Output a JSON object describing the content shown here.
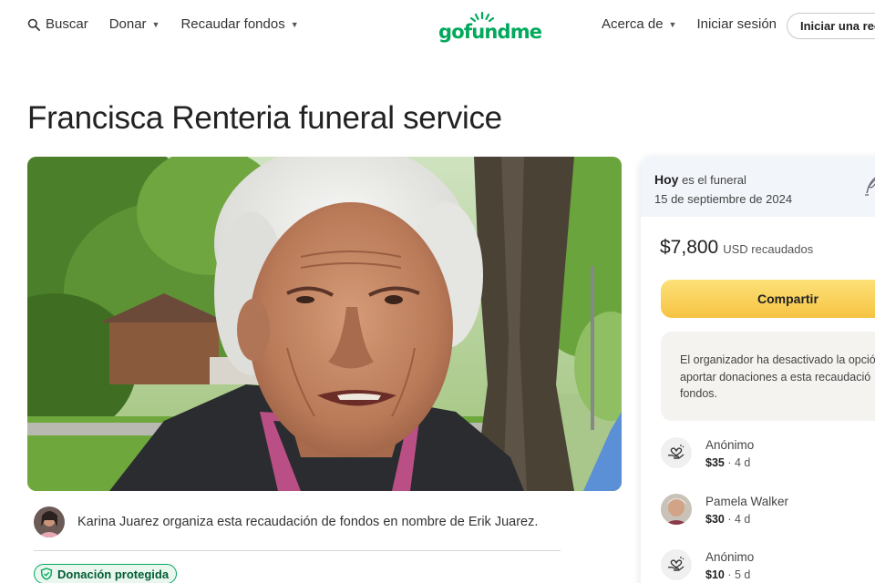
{
  "nav": {
    "search_label": "Buscar",
    "donate_label": "Donar",
    "fundraise_label": "Recaudar fondos",
    "logo_text": "gofundme",
    "about_label": "Acerca de",
    "signin_label": "Iniciar sesión",
    "start_label": "Iniciar una rec"
  },
  "campaign": {
    "title": "Francisca Renteria funeral service",
    "organizer_text": "Karina Juarez organiza esta recaudación de fondos en nombre de Erik Juarez.",
    "protected_badge": "Donación protegida"
  },
  "sidebar": {
    "event_today": "Hoy",
    "event_rest": " es el funeral",
    "event_date": "15 de septiembre de 2024",
    "amount": "$7,800",
    "amount_label": "USD recaudados",
    "share_label": "Compartir",
    "notice_line1": "El organizador ha desactivado la opció",
    "notice_line2": "aportar donaciones a esta recaudació",
    "notice_line3": "fondos.",
    "donors": [
      {
        "name": "Anónimo",
        "amount": "$35",
        "time": " · 4 d",
        "icon": "donation-heart-icon"
      },
      {
        "name": "Pamela Walker",
        "amount": "$30",
        "time": " · 4 d",
        "icon": "avatar"
      },
      {
        "name": "Anónimo",
        "amount": "$10",
        "time": " · 5 d",
        "icon": "donation-heart-icon"
      }
    ]
  },
  "colors": {
    "brand_green": "#02a95c",
    "share_yellow": "#f6c343",
    "card_header_bg": "#f2f5fa"
  }
}
